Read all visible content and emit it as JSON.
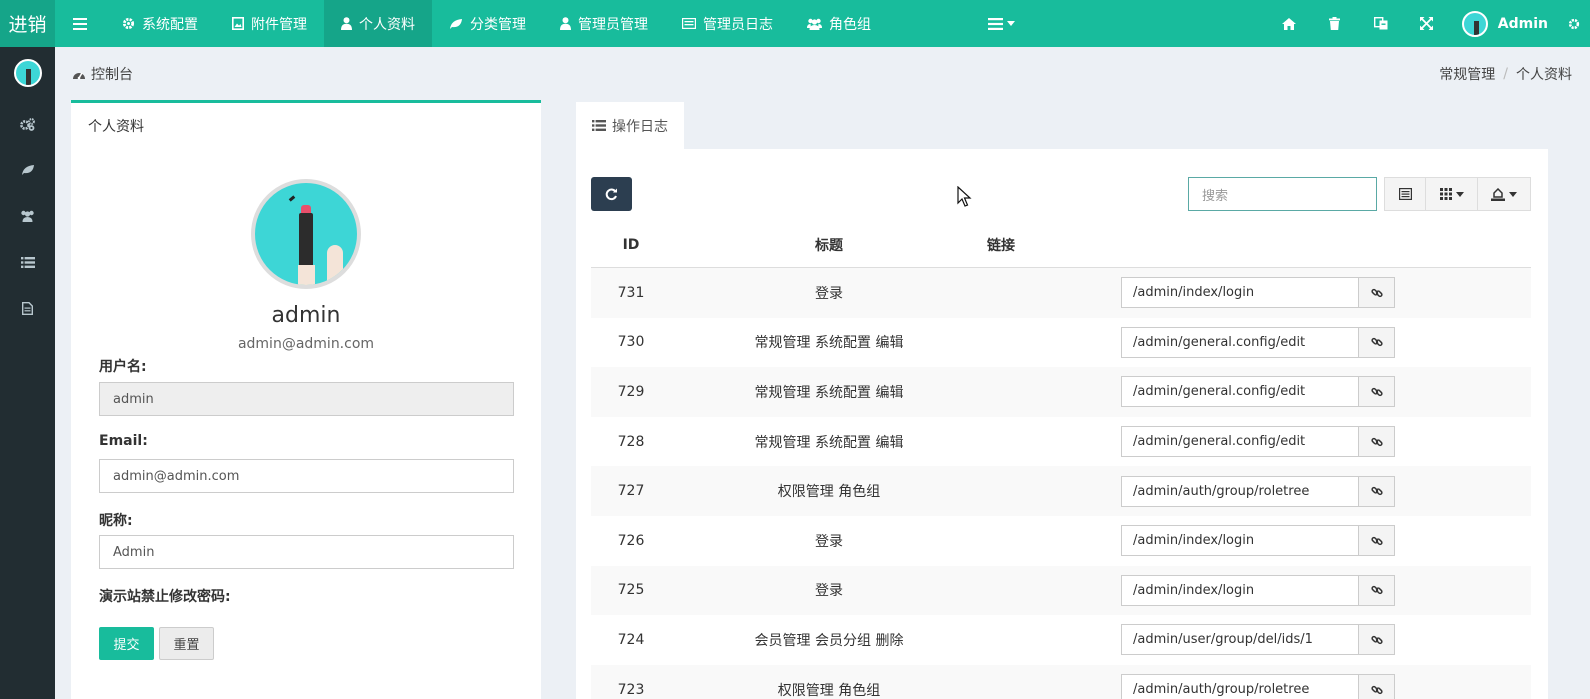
{
  "app": {
    "logo": "进销"
  },
  "topnav": {
    "items": [
      {
        "label": "系统配置",
        "icon": "gear-icon"
      },
      {
        "label": "附件管理",
        "icon": "image-icon"
      },
      {
        "label": "个人资料",
        "icon": "user-icon",
        "active": true
      },
      {
        "label": "分类管理",
        "icon": "leaf-icon"
      },
      {
        "label": "管理员管理",
        "icon": "user-icon"
      },
      {
        "label": "管理员日志",
        "icon": "list-icon"
      },
      {
        "label": "角色组",
        "icon": "group-icon"
      }
    ],
    "user_name": "Admin"
  },
  "breadcrumb": {
    "left": "控制台",
    "right_parent": "常规管理",
    "right_current": "个人资料"
  },
  "profile": {
    "panel_title": "个人资料",
    "name": "admin",
    "email": "admin@admin.com",
    "username_label": "用户名:",
    "username_value": "admin",
    "email_label": "Email:",
    "email_value": "admin@admin.com",
    "nickname_label": "昵称:",
    "nickname_value": "Admin",
    "password_label": "演示站禁止修改密码:",
    "submit_label": "提交",
    "reset_label": "重置"
  },
  "log": {
    "tab_label": "操作日志",
    "search_placeholder": "搜索",
    "columns": {
      "id": "ID",
      "title": "标题",
      "link": "链接"
    },
    "rows": [
      {
        "id": "731",
        "title": "登录",
        "url": "/admin/index/login"
      },
      {
        "id": "730",
        "title": "常规管理 系统配置 编辑",
        "url": "/admin/general.config/edit"
      },
      {
        "id": "729",
        "title": "常规管理 系统配置 编辑",
        "url": "/admin/general.config/edit"
      },
      {
        "id": "728",
        "title": "常规管理 系统配置 编辑",
        "url": "/admin/general.config/edit"
      },
      {
        "id": "727",
        "title": "权限管理 角色组",
        "url": "/admin/auth/group/roletree"
      },
      {
        "id": "726",
        "title": "登录",
        "url": "/admin/index/login"
      },
      {
        "id": "725",
        "title": "登录",
        "url": "/admin/index/login"
      },
      {
        "id": "724",
        "title": "会员管理 会员分组 删除",
        "url": "/admin/user/group/del/ids/1"
      },
      {
        "id": "723",
        "title": "权限管理 角色组",
        "url": "/admin/auth/group/roletree"
      }
    ]
  },
  "colors": {
    "primary": "#18bc9c",
    "sidebar": "#222d32",
    "dark_button": "#2c3e50"
  }
}
